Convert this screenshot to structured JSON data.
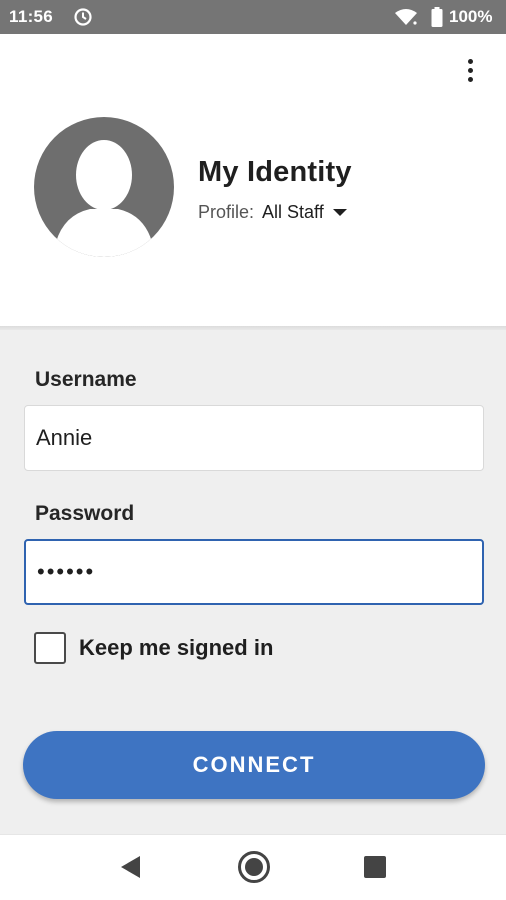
{
  "status_bar": {
    "time": "11:56",
    "battery": "100%",
    "icons": [
      "clock-icon",
      "wifi-icon",
      "battery-icon"
    ]
  },
  "header": {
    "title": "My Identity",
    "profile_label": "Profile:",
    "profile_value": "All Staff",
    "icons": [
      "overflow-menu-icon",
      "avatar-person-icon",
      "caret-down-icon"
    ]
  },
  "form": {
    "username_label": "Username",
    "username_value": "Annie",
    "password_label": "Password",
    "password_value": "••••••",
    "keep_signed_in_label": "Keep me signed in",
    "keep_signed_in_checked": false,
    "connect_label": "CONNECT"
  },
  "nav_bar": {
    "icons": [
      "back-icon",
      "home-icon",
      "recents-icon"
    ]
  },
  "colors": {
    "status_bar": "#757575",
    "accent": "#3e74c2",
    "focus_border": "#2f63b0",
    "form_background": "#efefef",
    "avatar": "#6e6e6e"
  }
}
